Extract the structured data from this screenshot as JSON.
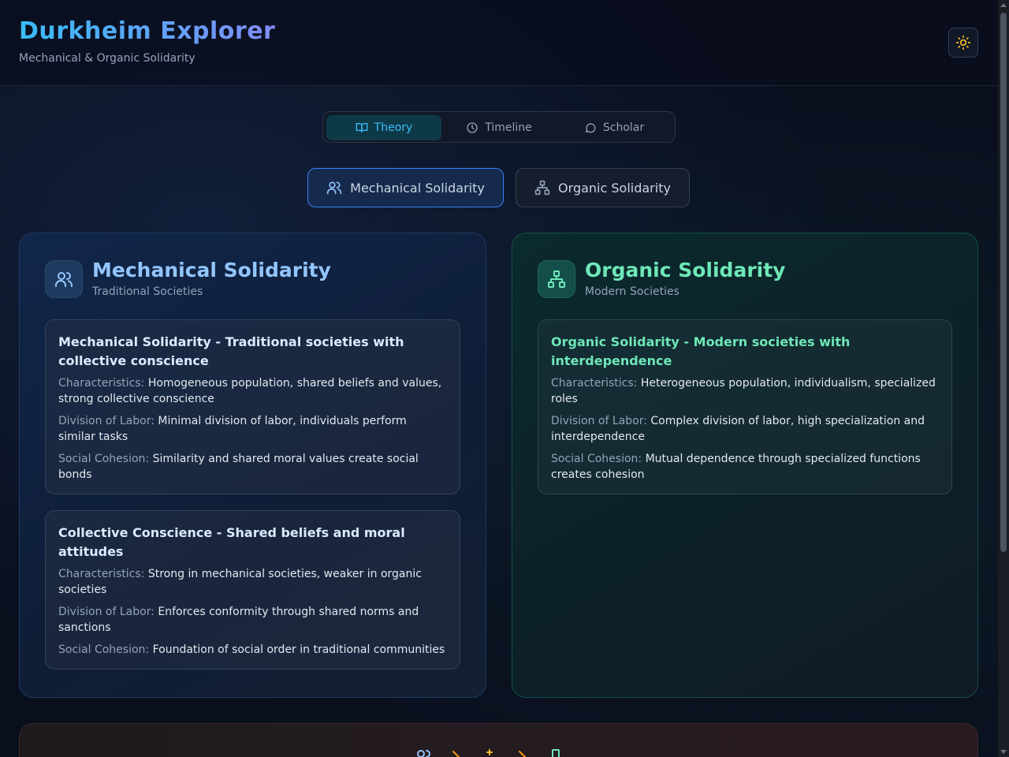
{
  "header": {
    "title": "Durkheim Explorer",
    "subtitle": "Mechanical & Organic Solidarity",
    "theme_icon": "sun-icon"
  },
  "main_tabs": [
    {
      "label": "Theory",
      "icon": "book-icon",
      "active": true
    },
    {
      "label": "Timeline",
      "icon": "clock-icon",
      "active": false
    },
    {
      "label": "Scholar",
      "icon": "chat-icon",
      "active": false
    }
  ],
  "solidarity_toggle": [
    {
      "label": "Mechanical Solidarity",
      "icon": "users-icon",
      "active": true
    },
    {
      "label": "Organic Solidarity",
      "icon": "network-icon",
      "active": false
    }
  ],
  "mechanical": {
    "title": "Mechanical Solidarity",
    "subtitle": "Traditional Societies",
    "cards": [
      {
        "title": "Mechanical Solidarity - Traditional societies with collective conscience",
        "rows": [
          {
            "label": "Characteristics:",
            "value": "Homogeneous population, shared beliefs and values, strong collective conscience"
          },
          {
            "label": "Division of Labor:",
            "value": "Minimal division of labor, individuals perform similar tasks"
          },
          {
            "label": "Social Cohesion:",
            "value": "Similarity and shared moral values create social bonds"
          }
        ]
      },
      {
        "title": "Collective Conscience - Shared beliefs and moral attitudes",
        "rows": [
          {
            "label": "Characteristics:",
            "value": "Strong in mechanical societies, weaker in organic societies"
          },
          {
            "label": "Division of Labor:",
            "value": "Enforces conformity through shared norms and sanctions"
          },
          {
            "label": "Social Cohesion:",
            "value": "Foundation of social order in traditional communities"
          }
        ]
      }
    ]
  },
  "organic": {
    "title": "Organic Solidarity",
    "subtitle": "Modern Societies",
    "cards": [
      {
        "title": "Organic Solidarity - Modern societies with interdependence",
        "rows": [
          {
            "label": "Characteristics:",
            "value": "Heterogeneous population, individualism, specialized roles"
          },
          {
            "label": "Division of Labor:",
            "value": "Complex division of labor, high specialization and interdependence"
          },
          {
            "label": "Social Cohesion:",
            "value": "Mutual dependence through specialized functions creates cohesion"
          }
        ]
      }
    ]
  },
  "colors": {
    "accent_cyan": "#38bdf8",
    "mechanical_blue": "#93c5fd",
    "organic_green": "#6ee7b7",
    "sun_yellow": "#fbbf24"
  }
}
